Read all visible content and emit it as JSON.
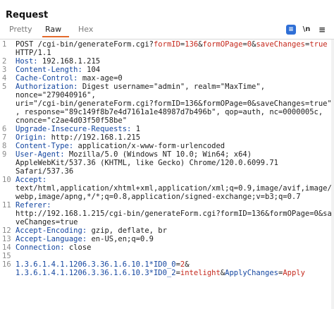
{
  "panel": {
    "title": "Request"
  },
  "tabs": [
    {
      "label": "Pretty"
    },
    {
      "label": "Raw"
    },
    {
      "label": "Hex"
    }
  ],
  "toolbar": {
    "pretty_icon": "≡",
    "newline_label": "\\n",
    "menu_icon": "≡"
  },
  "editor": {
    "lines": [
      {
        "n": "1",
        "t": "POST /cgi-bin/generateForm.cgi?formID=136&formOPage=0&saveChanges=true"
      },
      {
        "n": "",
        "t": "HTTP/1.1"
      },
      {
        "n": "2",
        "t": "Host: 192.168.1.215"
      },
      {
        "n": "3",
        "t": "Content-Length: 104"
      },
      {
        "n": "4",
        "t": "Cache-Control: max-age=0"
      },
      {
        "n": "5",
        "t": "Authorization: Digest username=\"admin\", realm=\"MaxTime\","
      },
      {
        "n": "",
        "t": "nonce=\"279040916\","
      },
      {
        "n": "",
        "t": "uri=\"/cgi-bin/generateForm.cgi?formID=136&formOPage=0&saveChanges=true\""
      },
      {
        "n": "",
        "t": ", response=\"89c149f8b7e4d7161a1e48987d7b496b\", qop=auth, nc=0000005c,"
      },
      {
        "n": "",
        "t": "cnonce=\"c2ae4d03f50f58be\""
      },
      {
        "n": "6",
        "t": "Upgrade-Insecure-Requests: 1"
      },
      {
        "n": "7",
        "t": "Origin: http://192.168.1.215"
      },
      {
        "n": "8",
        "t": "Content-Type: application/x-www-form-urlencoded"
      },
      {
        "n": "9",
        "t": "User-Agent: Mozilla/5.0 (Windows NT 10.0; Win64; x64)"
      },
      {
        "n": "",
        "t": "AppleWebKit/537.36 (KHTML, like Gecko) Chrome/120.0.6099.71"
      },
      {
        "n": "",
        "t": "Safari/537.36"
      },
      {
        "n": "10",
        "t": "Accept:"
      },
      {
        "n": "",
        "t": "text/html,application/xhtml+xml,application/xml;q=0.9,image/avif,image/"
      },
      {
        "n": "",
        "t": "webp,image/apng,*/*;q=0.8,application/signed-exchange;v=b3;q=0.7"
      },
      {
        "n": "11",
        "t": "Referer:"
      },
      {
        "n": "",
        "t": "http://192.168.1.215/cgi-bin/generateForm.cgi?formID=136&formOPage=0&sa"
      },
      {
        "n": "",
        "t": "veChanges=true"
      },
      {
        "n": "12",
        "t": "Accept-Encoding: gzip, deflate, br"
      },
      {
        "n": "13",
        "t": "Accept-Language: en-US,en;q=0.9"
      },
      {
        "n": "14",
        "t": "Connection: close"
      },
      {
        "n": "15",
        "t": ""
      },
      {
        "n": "16",
        "t": "1.3.6.1.4.1.1206.3.36.1.6.10.1*ID0_0=2&"
      },
      {
        "n": "",
        "t": "1.3.6.1.4.1.1206.3.36.1.6.10.3*ID0_2=intelight&ApplyChanges=Apply"
      }
    ]
  }
}
